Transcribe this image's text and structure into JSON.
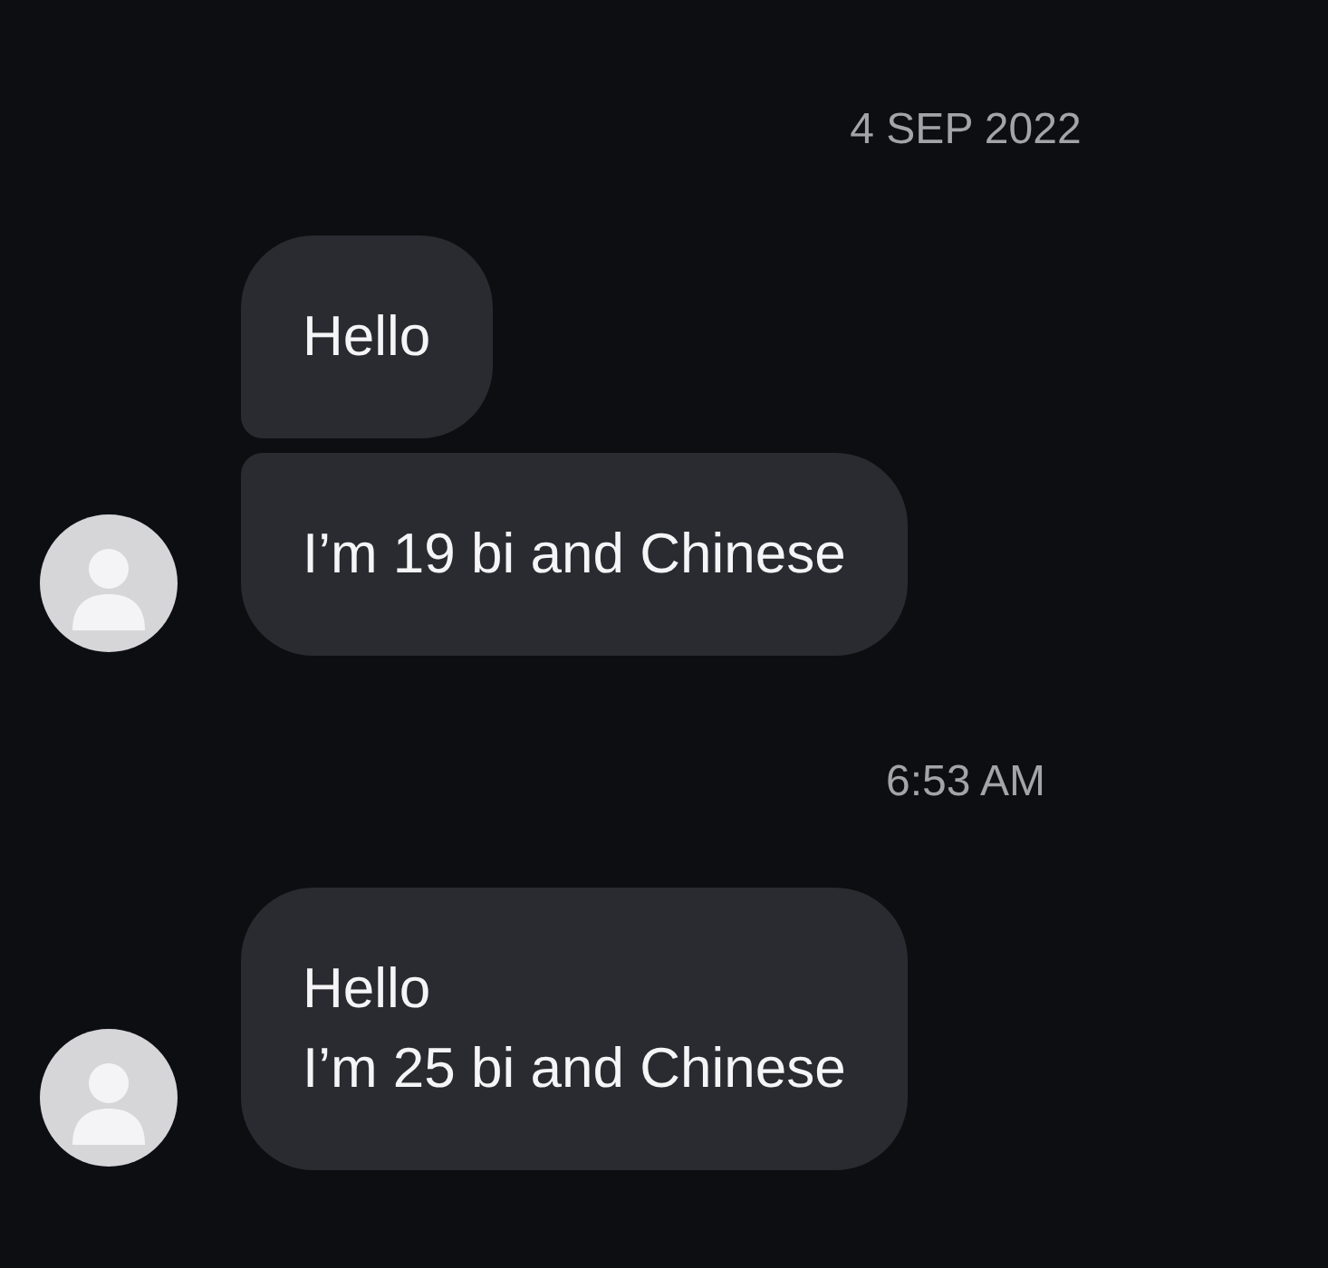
{
  "groups": [
    {
      "timestamp": "4 SEP 2022",
      "messages": [
        {
          "text": "Hello",
          "avatar": false
        },
        {
          "text": "I’m 19 bi and Chinese",
          "avatar": true
        }
      ]
    },
    {
      "timestamp": "6:53 AM",
      "messages": [
        {
          "text": "Hello\nI’m 25 bi and Chinese",
          "avatar": true
        }
      ]
    }
  ]
}
